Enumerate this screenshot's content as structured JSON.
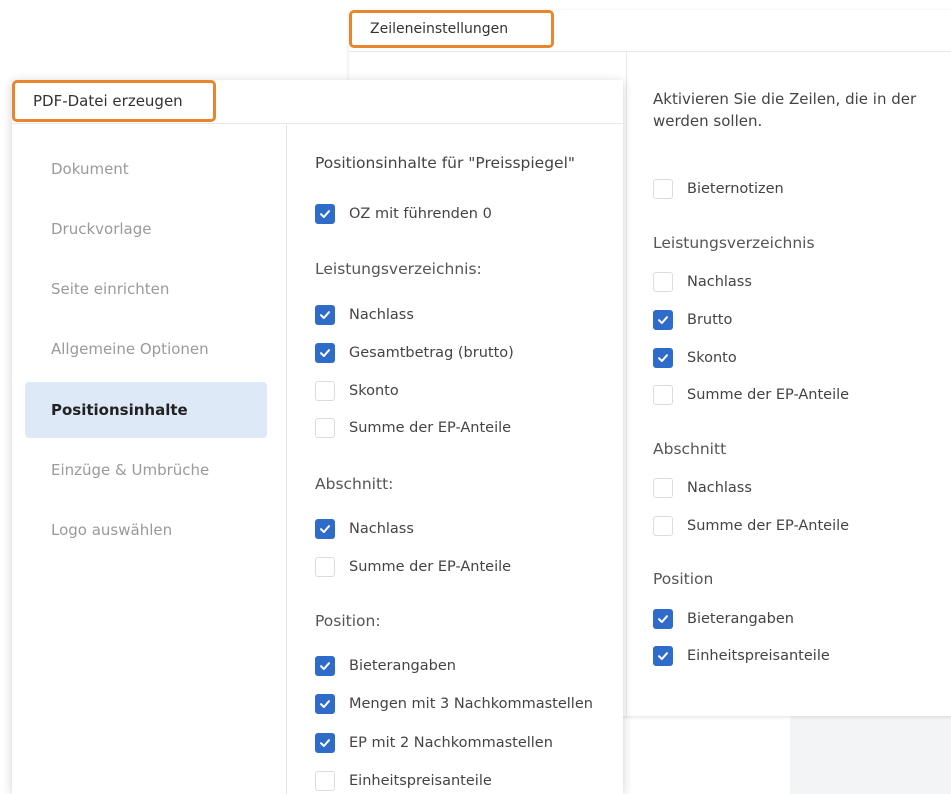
{
  "back_dialog": {
    "title": "Zeileneinstellungen",
    "intro": "Aktivieren Sie die Zeilen, die in der werden sollen.",
    "top_option": {
      "label": "Bieternotizen",
      "checked": false
    },
    "sections": [
      {
        "title": "Leistungsverzeichnis",
        "options": [
          {
            "label": "Nachlass",
            "checked": false
          },
          {
            "label": "Brutto",
            "checked": true
          },
          {
            "label": "Skonto",
            "checked": true
          },
          {
            "label": "Summe der EP-Anteile",
            "checked": false
          }
        ]
      },
      {
        "title": "Abschnitt",
        "options": [
          {
            "label": "Nachlass",
            "checked": false
          },
          {
            "label": "Summe der EP-Anteile",
            "checked": false
          }
        ]
      },
      {
        "title": "Position",
        "options": [
          {
            "label": "Bieterangaben",
            "checked": true
          },
          {
            "label": "Einheitspreisanteile",
            "checked": true
          }
        ]
      }
    ]
  },
  "front_dialog": {
    "title": "PDF-Datei erzeugen",
    "nav": [
      {
        "label": "Dokument",
        "active": false
      },
      {
        "label": "Druckvorlage",
        "active": false
      },
      {
        "label": "Seite einrichten",
        "active": false
      },
      {
        "label": "Allgemeine Optionen",
        "active": false
      },
      {
        "label": "Positionsinhalte",
        "active": true
      },
      {
        "label": "Einzüge & Umbrüche",
        "active": false
      },
      {
        "label": "Logo auswählen",
        "active": false
      }
    ],
    "content": {
      "heading": "Positionsinhalte für \"Preisspiegel\"",
      "top_option": {
        "label": "OZ mit führenden 0",
        "checked": true
      },
      "sections": [
        {
          "title": "Leistungsverzeichnis:",
          "options": [
            {
              "label": "Nachlass",
              "checked": true
            },
            {
              "label": "Gesamtbetrag (brutto)",
              "checked": true
            },
            {
              "label": "Skonto",
              "checked": false
            },
            {
              "label": "Summe der EP-Anteile",
              "checked": false
            }
          ]
        },
        {
          "title": "Abschnitt:",
          "options": [
            {
              "label": "Nachlass",
              "checked": true
            },
            {
              "label": "Summe der EP-Anteile",
              "checked": false
            }
          ]
        },
        {
          "title": "Position:",
          "options": [
            {
              "label": "Bieterangaben",
              "checked": true
            },
            {
              "label": "Mengen mit 3 Nachkommastellen",
              "checked": true
            },
            {
              "label": "EP mit 2 Nachkommastellen",
              "checked": true
            },
            {
              "label": "Einheitspreisanteile",
              "checked": false
            }
          ]
        }
      ]
    }
  },
  "colors": {
    "accent": "#2f6cc9",
    "highlight": "#e8852d",
    "active_nav": "#dde9f7"
  },
  "icons": {
    "checkbox_check": "check-icon"
  }
}
